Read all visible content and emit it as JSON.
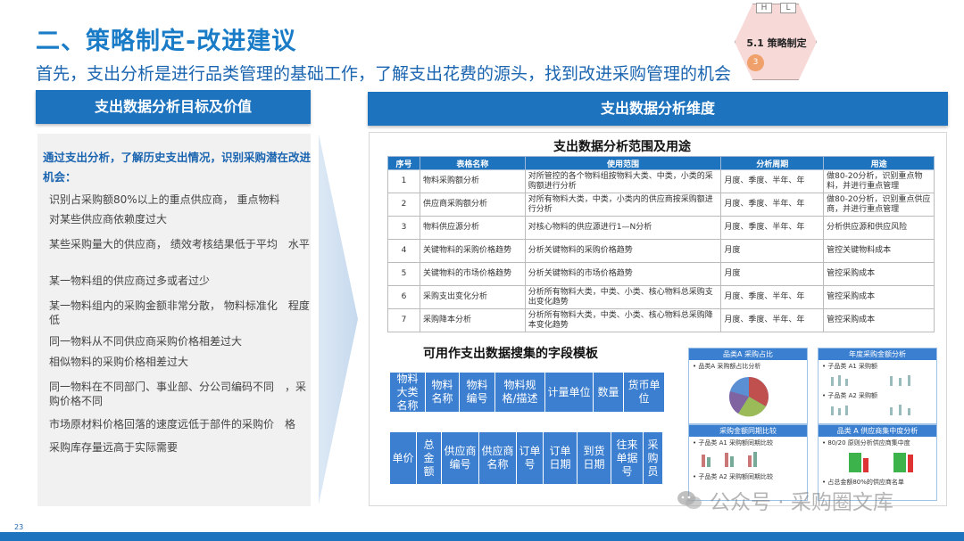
{
  "title": "二、策略制定-改进建议",
  "subtitle": "首先，支出分析是进行品类管理的基础工作，了解支出花费的源头，找到改进采购管理的机会",
  "badge": {
    "h": "H",
    "l": "L",
    "label": "5.1 策略制定",
    "num": "3"
  },
  "left": {
    "header": "支出数据分析目标及价值",
    "intro": "通过支出分析，了解历史支出情况，识别采购潜在改进机会：",
    "items": [
      "识别占采购额80%以上的重点供应商， 重点物料",
      "对某些供应商依赖度过大",
      "某些采购量大的供应商， 绩效考核结果低于平均　水平",
      "某一物料组的供应商过多或者过少",
      "某一物料组内的采购金额非常分散， 物料标准化　程度低",
      "同一物料从不同供应商采购价格相差过大",
      "相似物料的采购价格相差过大",
      "同一物料在不同部门、事业部、分公司编码不同　，采购价格不同",
      "市场原材料价格回落的速度远低于部件的采购价　格",
      "采购库存量远高于实际需要"
    ]
  },
  "right": {
    "header": "支出数据分析维度",
    "table_title": "支出数据分析范围及用途",
    "columns": [
      "序号",
      "表格名称",
      "使用范围",
      "分析周期",
      "用途"
    ],
    "rows": [
      [
        "1",
        "物料采购额分析",
        "对所管控的各个物料组按物料大类、中类，小类的采购额进行分析",
        "月度、季度、半年、年",
        "做80-20分析，识别重点物料，并进行重点管理"
      ],
      [
        "2",
        "供应商采购额分析",
        "对所有物料大类，中类，小类内的供应商按采购额进行分析",
        "月度、季度、半年、年",
        "做80-20分析，识别重点供应商，并进行重点管理"
      ],
      [
        "3",
        "物料供应源分析",
        "对核心物料的供应源进行1—N分析",
        "月度、季度、半年、年",
        "分析供应源和供应风险"
      ],
      [
        "4",
        "关键物料的采购价格趋势",
        "分析关键物料的采购价格趋势",
        "月度",
        "管控关键物料成本"
      ],
      [
        "5",
        "关键物料的市场价格趋势",
        "分析关键物料的市场价格趋势",
        "月度",
        "管控采购成本"
      ],
      [
        "6",
        "采购支出变化分析",
        "分析所有物料大类，中类、小类、核心物料总采购支出变化趋势",
        "月度、季度、半年、年",
        "管控采购成本"
      ],
      [
        "7",
        "采购降本分析",
        "分析所有物料大类，中类、小类、核心物料总采购降本变化趋势",
        "月度、季度、半年、年",
        "管控采购成本"
      ]
    ],
    "template_title": "可用作支出数据搜集的字段模板",
    "template_row1": [
      "物料大类名称",
      "物料名称",
      "物料编号",
      "物料规格/描述",
      "计量单位",
      "数量",
      "货币单位"
    ],
    "template_row2": [
      "单价",
      "总金额",
      "供应商编号",
      "供应商名称",
      "订单号",
      "订单日期",
      "到货日期",
      "往来单据号",
      "采购员"
    ],
    "minis": [
      {
        "title": "品类A 采购占比",
        "lines": [
          "• 品类A 采购额占比分析"
        ]
      },
      {
        "title": "年度采购金额分析",
        "lines": [
          "• 子品类 A1 采购额",
          "• 子品类 A2 采购额"
        ]
      },
      {
        "title": "采购金额同期比较",
        "lines": [
          "• 子品类 A1 采购额同期比较",
          "• 子品类 A2 采购额同期比较"
        ]
      },
      {
        "title": "品类 A 供应商集中度分析",
        "lines": [
          "• 80/20 原则分析供应商集中度",
          "• 占总金额80%的供应商名单"
        ]
      }
    ]
  },
  "page_number": "23",
  "watermark": "公众号 · 采购圈文库",
  "colors": {
    "accent": "#1e73be",
    "title": "#1a7bc7",
    "badge_fill": "#f7d9d7",
    "badge_num": "#f0a06a"
  }
}
